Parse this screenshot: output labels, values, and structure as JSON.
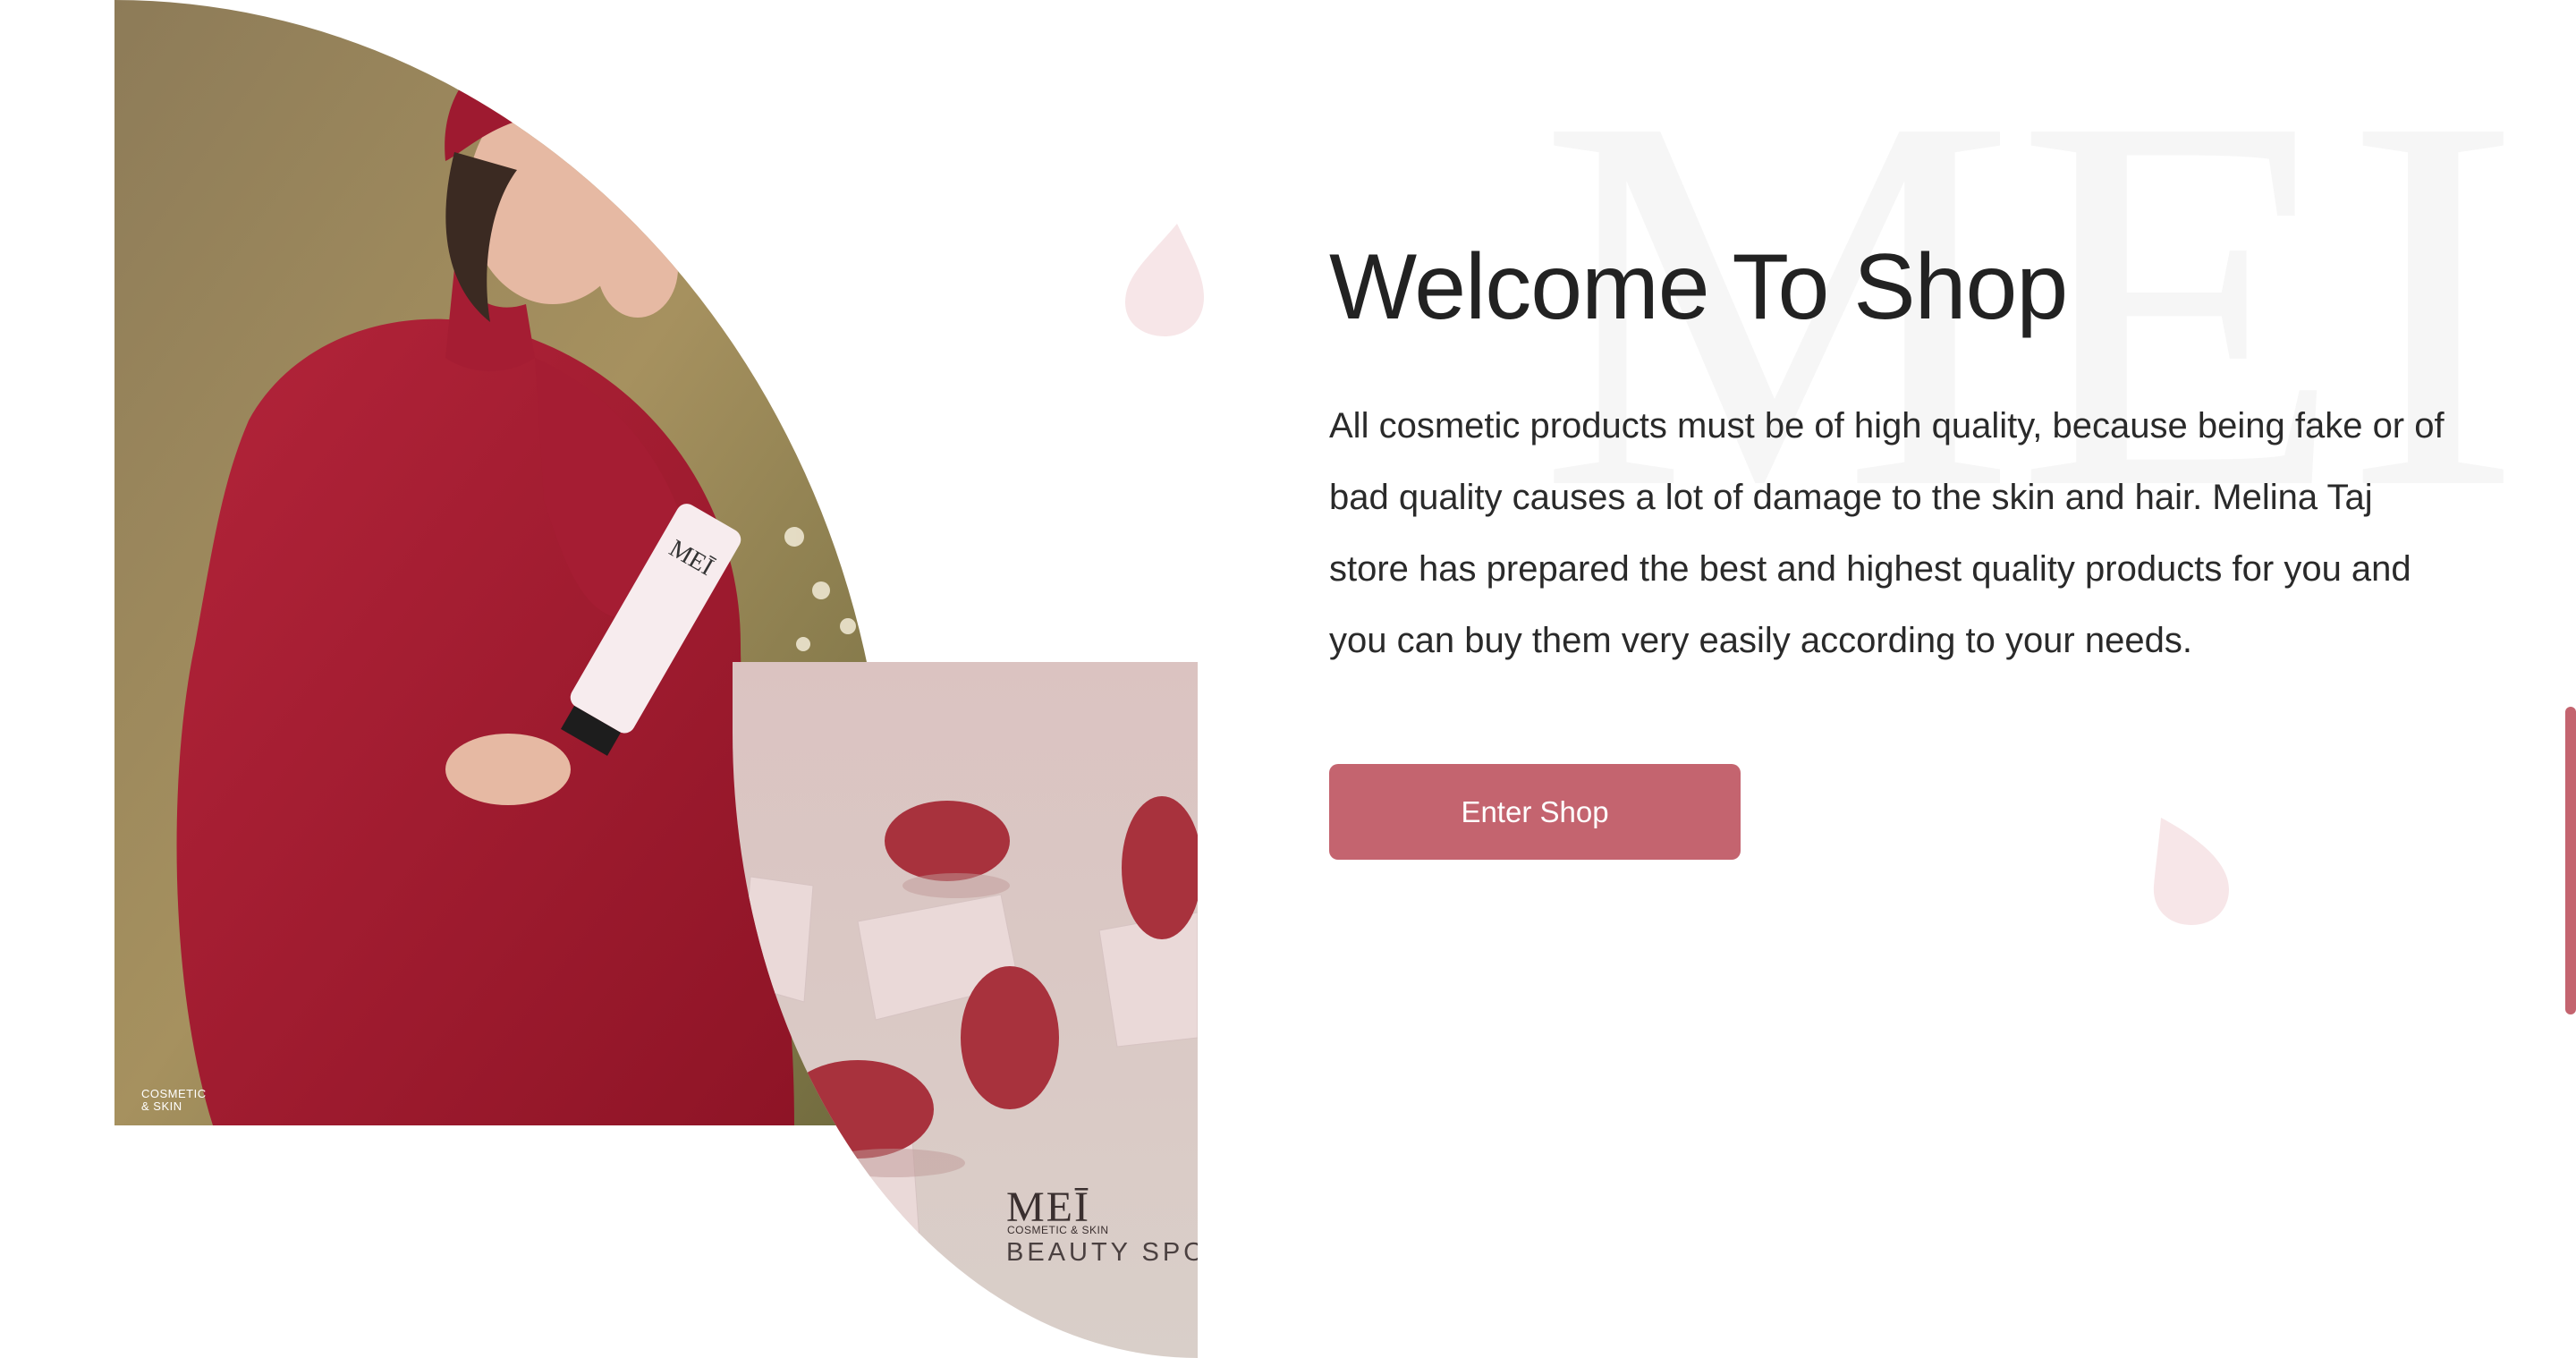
{
  "hero": {
    "watermark_text": "MEI",
    "title": "Welcome To Shop",
    "description": "All cosmetic products must be of high quality, because being fake or of bad quality causes a lot of damage to the skin and hair. Melina Taj store has prepared the best and highest quality products for you and you can buy them very easily according to your needs.",
    "cta_label": "Enter Shop"
  },
  "images": {
    "model_caption_line1": "COSMETIC",
    "model_caption_line2": "& SKIN",
    "sponge_logo": "MEĪ",
    "sponge_logo_sub": "COSMETIC & SKIN",
    "sponge_product_name": "BEAUTY SPONGE"
  },
  "colors": {
    "accent": "#c4646f",
    "drop_tint": "#f7e6e8",
    "watermark": "#f5f5f5"
  }
}
